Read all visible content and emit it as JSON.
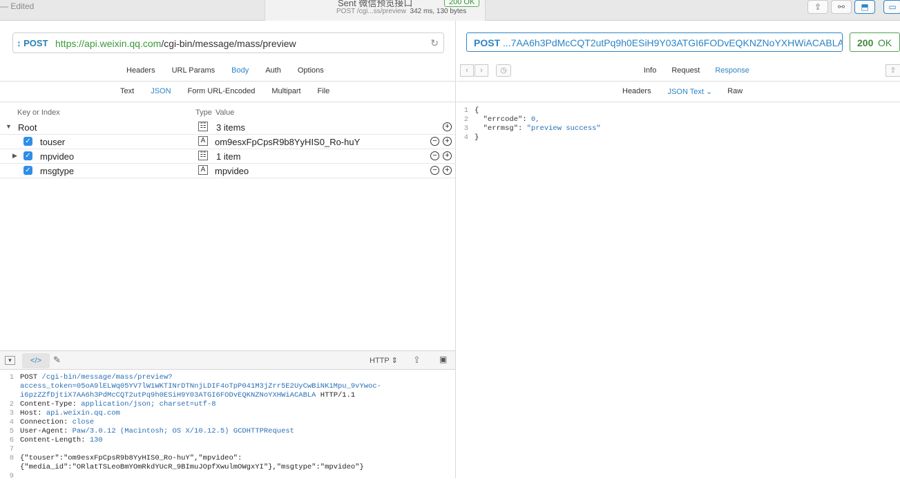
{
  "titlebar": {
    "edited": "— Edited",
    "sent": "Sent 微信预览接口",
    "status_badge": "200 OK",
    "path": "POST /cgi...ss/preview",
    "meta": "342 ms, 130 bytes"
  },
  "request": {
    "method": "POST",
    "url_scheme": "https://",
    "url_host": "api.weixin.qq.com",
    "url_path": "/cgi-bin/message/mass/preview",
    "tabs": [
      "Headers",
      "URL Params",
      "Body",
      "Auth",
      "Options"
    ],
    "active_tab": "Body",
    "body_tabs": [
      "Text",
      "JSON",
      "Form URL-Encoded",
      "Multipart",
      "File"
    ],
    "active_body_tab": "JSON",
    "tree_headers": {
      "key": "Key or Index",
      "type": "Type",
      "value": "Value"
    },
    "tree": {
      "root_label": "Root",
      "root_value": "3 items",
      "items": [
        {
          "key": "touser",
          "value": "om9esxFpCpsR9b8YyHIS0_Ro-huY",
          "type_icon": "string-icon"
        },
        {
          "key": "mpvideo",
          "value": "1 item",
          "type_icon": "dictionary-icon"
        },
        {
          "key": "msgtype",
          "value": "mpvideo",
          "type_icon": "string-icon"
        }
      ]
    }
  },
  "raw": {
    "format": "HTTP",
    "lines": [
      {
        "n": "1",
        "a": "POST ",
        "b": "/cgi-bin/message/mass/preview?"
      },
      {
        "n": "",
        "a": "",
        "b": "access_token=05oA9lELWq05YV7lW1WKTINrDTNnjLDIF4oTpP041M3jZrr5E2UyCwBiNK1Mpu_9vYwoc-"
      },
      {
        "n": "",
        "a": "",
        "b": "i6pzZZfDjtiX7AA6h3PdMcCQT2utPq9h0ESiH9Y03ATGI6FODvEQKNZNoYXHWiACABLA",
        "c": " HTTP/1.1"
      },
      {
        "n": "2",
        "a": "Content-Type: ",
        "b": "application/json; charset=utf-8"
      },
      {
        "n": "3",
        "a": "Host: ",
        "b": "api.weixin.qq.com"
      },
      {
        "n": "4",
        "a": "Connection: ",
        "b": "close"
      },
      {
        "n": "5",
        "a": "User-Agent: ",
        "b": "Paw/3.0.12 (Macintosh; OS X/10.12.5) GCDHTTPRequest"
      },
      {
        "n": "6",
        "a": "Content-Length: ",
        "b": "130"
      },
      {
        "n": "7",
        "a": "",
        "b": ""
      },
      {
        "n": "8",
        "a": "{\"touser\":\"om9esxFpCpsR9b8YyHIS0_Ro-huY\",\"mpvideo\":",
        "b": ""
      },
      {
        "n": "",
        "a": "{\"media_id\":\"ORlatTSLeoBmYOmRkdYUcR_9BImuJOpfXwulmOWgxYI\"},\"msgtype\":\"mpvideo\"}",
        "b": ""
      },
      {
        "n": "9",
        "a": "",
        "b": ""
      }
    ]
  },
  "response": {
    "method": "POST",
    "url_tail": "...7AA6h3PdMcCQT2utPq9h0ESiH9Y03ATGI6FODvEQKNZNoYXHWiACABLA",
    "status_code": "200",
    "status_text": "OK",
    "tabs": [
      "Info",
      "Request",
      "Response"
    ],
    "active_tab": "Response",
    "sub_tabs": [
      "Headers",
      "JSON Text",
      "Raw"
    ],
    "active_sub_tab": "JSON Text",
    "json_lines": [
      {
        "n": "1",
        "text": "{"
      },
      {
        "n": "2",
        "key": "  \"errcode\"",
        "sep": ": ",
        "val": "0,"
      },
      {
        "n": "3",
        "key": "  \"errmsg\"",
        "sep": ": ",
        "val": "\"preview success\""
      },
      {
        "n": "4",
        "text": "}"
      }
    ]
  },
  "colors": {
    "accent": "#2a84c6",
    "ok": "#3d8b3d",
    "host": "#3a9a3a"
  }
}
